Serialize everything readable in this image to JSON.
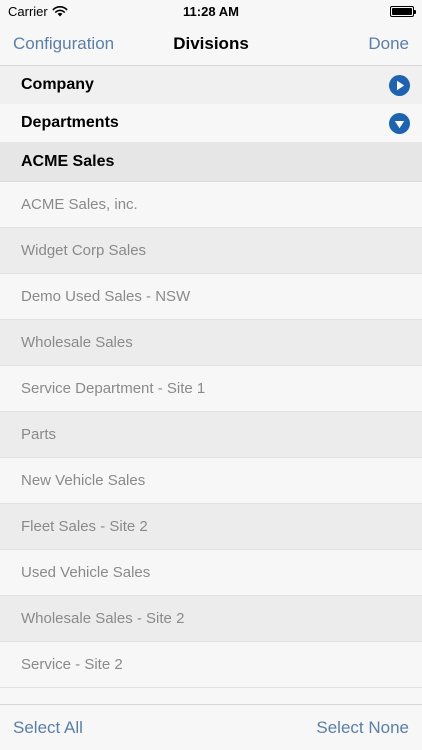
{
  "status_bar": {
    "carrier": "Carrier",
    "time": "11:28 AM"
  },
  "nav": {
    "back_label": "Configuration",
    "title": "Divisions",
    "done_label": "Done"
  },
  "sections": {
    "company_label": "Company",
    "departments_label": "Departments"
  },
  "group_header": "ACME Sales",
  "divisions": [
    "ACME Sales, inc.",
    "Widget Corp Sales",
    "Demo Used Sales - NSW",
    "Wholesale Sales",
    "Service Department - Site 1",
    "Parts",
    "New Vehicle Sales",
    "Fleet Sales - Site 2",
    "Used Vehicle Sales",
    "Wholesale Sales - Site 2",
    "Service - Site 2"
  ],
  "toolbar": {
    "select_all_label": "Select All",
    "select_none_label": "Select None"
  },
  "colors": {
    "accent": "#5b7fa6",
    "disclosure": "#1f63b0"
  }
}
